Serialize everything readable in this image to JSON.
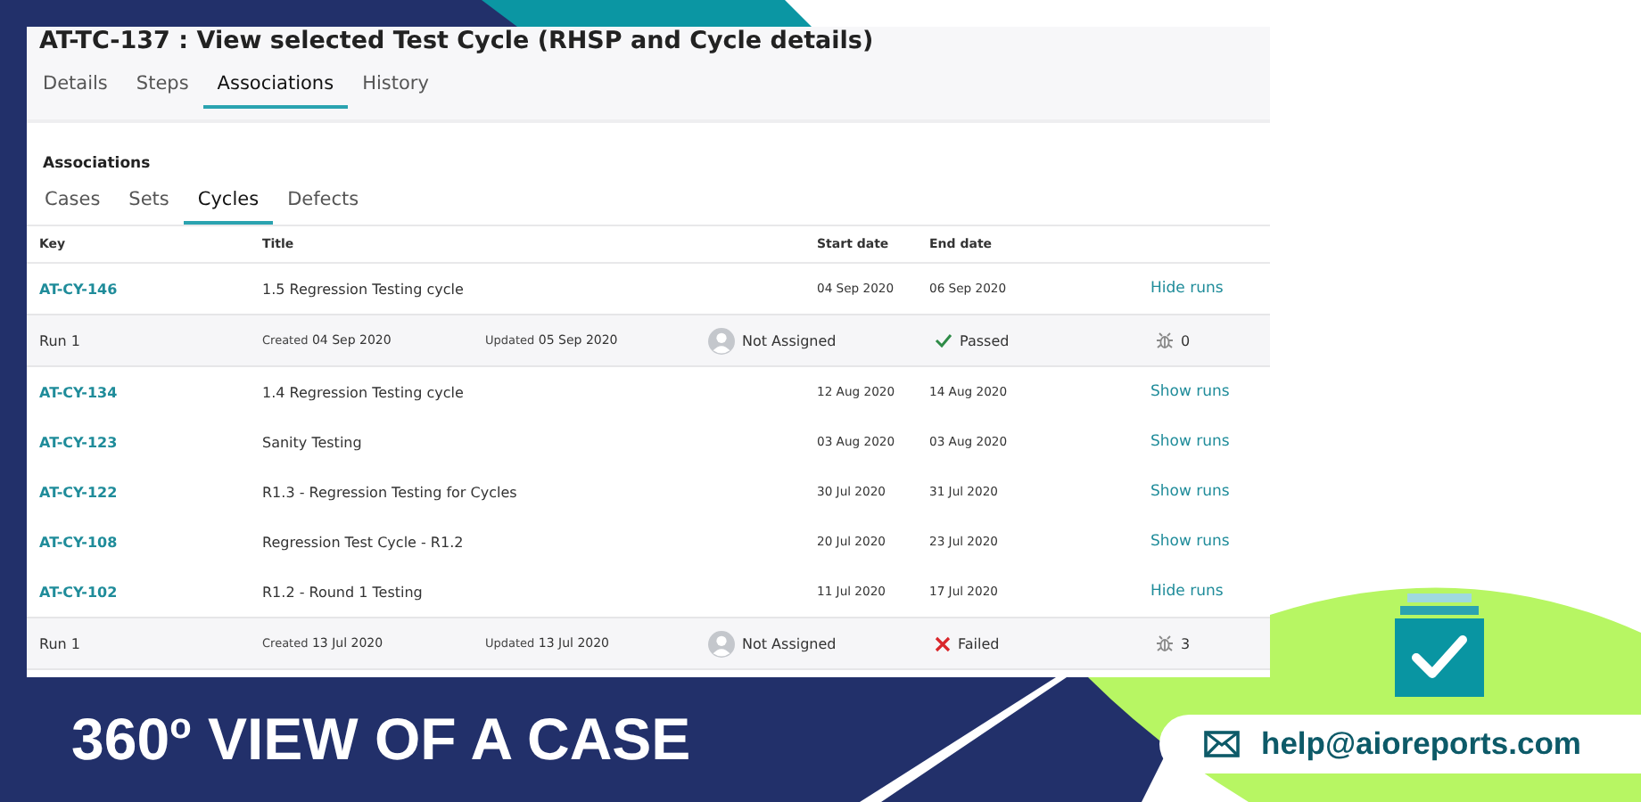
{
  "header": {
    "title": "AT-TC-137 : View selected Test Cycle (RHSP and Cycle details)",
    "tabs": [
      {
        "label": "Details",
        "selected": false
      },
      {
        "label": "Steps",
        "selected": false
      },
      {
        "label": "Associations",
        "selected": true
      },
      {
        "label": "History",
        "selected": false
      }
    ]
  },
  "associations": {
    "heading": "Associations",
    "tabs": [
      {
        "label": "Cases",
        "selected": false
      },
      {
        "label": "Sets",
        "selected": false
      },
      {
        "label": "Cycles",
        "selected": true
      },
      {
        "label": "Defects",
        "selected": false
      }
    ]
  },
  "table": {
    "columns": [
      "Key",
      "Title",
      "Start date",
      "End date"
    ],
    "rows": [
      {
        "kind": "cycle",
        "key": "AT-CY-146",
        "title": "1.5 Regression Testing cycle",
        "start": "04 Sep 2020",
        "end": "06 Sep 2020",
        "action": "Hide runs"
      },
      {
        "kind": "run",
        "name": "Run 1",
        "created_label": "Created",
        "created": "04 Sep 2020",
        "updated_label": "Updated",
        "updated": "05 Sep 2020",
        "assignee": "Not Assigned",
        "status": {
          "kind": "passed",
          "label": "Passed"
        },
        "defects": "0"
      },
      {
        "kind": "cycle",
        "key": "AT-CY-134",
        "title": "1.4 Regression Testing cycle",
        "start": "12 Aug 2020",
        "end": "14 Aug 2020",
        "action": "Show runs"
      },
      {
        "kind": "cycle",
        "key": "AT-CY-123",
        "title": "Sanity Testing",
        "start": "03 Aug 2020",
        "end": "03 Aug 2020",
        "action": "Show runs"
      },
      {
        "kind": "cycle",
        "key": "AT-CY-122",
        "title": "R1.3 - Regression Testing for Cycles",
        "start": "30 Jul 2020",
        "end": "31 Jul 2020",
        "action": "Show runs"
      },
      {
        "kind": "cycle",
        "key": "AT-CY-108",
        "title": "Regression Test Cycle - R1.2",
        "start": "20 Jul 2020",
        "end": "23 Jul 2020",
        "action": "Show runs"
      },
      {
        "kind": "cycle",
        "key": "AT-CY-102",
        "title": "R1.2 - Round 1 Testing",
        "start": "11 Jul 2020",
        "end": "17 Jul 2020",
        "action": "Hide runs"
      },
      {
        "kind": "run",
        "name": "Run 1",
        "created_label": "Created",
        "created": "13 Jul 2020",
        "updated_label": "Updated",
        "updated": "13 Jul 2020",
        "assignee": "Not Assigned",
        "status": {
          "kind": "failed",
          "label": "Failed"
        },
        "defects": "3"
      }
    ]
  },
  "banner": {
    "title": "360$^{o}$ VIEW OF A CASE",
    "email": "help@aioreports.com"
  }
}
